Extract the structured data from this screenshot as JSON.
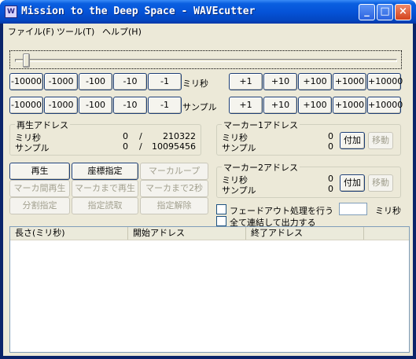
{
  "window": {
    "title": "Mission to the Deep Space - WAVEcutter",
    "icon_name": "app-icon",
    "controls": {
      "minimize": "_",
      "maximize": "□",
      "close": "×"
    }
  },
  "menu": [
    {
      "label": "ファイル(F)"
    },
    {
      "label": "ツール(T)"
    },
    {
      "label": "ヘルプ(H)"
    }
  ],
  "seek": {
    "position_fraction": 0.02
  },
  "millisecond_row": {
    "minus": [
      "-10000",
      "-1000",
      "-100",
      "-10",
      "-1"
    ],
    "unit": "ミリ秒",
    "plus": [
      "+1",
      "+10",
      "+100",
      "+1000",
      "+10000"
    ]
  },
  "sample_row": {
    "minus": [
      "-10000",
      "-1000",
      "-100",
      "-10",
      "-1"
    ],
    "unit": "サンプル",
    "plus": [
      "+1",
      "+10",
      "+100",
      "+1000",
      "+10000"
    ]
  },
  "playback_address": {
    "title": "再生アドレス",
    "ms_label": "ミリ秒",
    "ms_current": "0",
    "ms_sep": "/",
    "ms_total": "210322",
    "sample_label": "サンプル",
    "sample_current": "0",
    "sample_sep": "/",
    "sample_total": "10095456"
  },
  "marker1": {
    "title": "マーカー1アドレス",
    "ms_label": "ミリ秒",
    "ms_value": "0",
    "sample_label": "サンプル",
    "sample_value": "0",
    "add_label": "付加",
    "move_label": "移動"
  },
  "marker2": {
    "title": "マーカー2アドレス",
    "ms_label": "ミリ秒",
    "ms_value": "0",
    "sample_label": "サンプル",
    "sample_value": "0",
    "add_label": "付加",
    "move_label": "移動"
  },
  "actions": {
    "play": "再生",
    "coord": "座標指定",
    "marker_loop": "マーカループ",
    "marker_between": "マーカ間再生",
    "until_marker": "マーカまで再生",
    "until_marker_2s": "マーカまで2秒",
    "split": "分割指定",
    "load_spec": "指定読取",
    "clear_spec": "指定解除"
  },
  "options": {
    "fade_out": "フェードアウト処理を行う",
    "fade_ms_value": "",
    "fade_unit": "ミリ秒",
    "concat_output": "全て連結して出力する"
  },
  "list": {
    "columns": [
      "長さ(ミリ秒)",
      "開始アドレス",
      "終了アドレス"
    ],
    "rows": []
  }
}
